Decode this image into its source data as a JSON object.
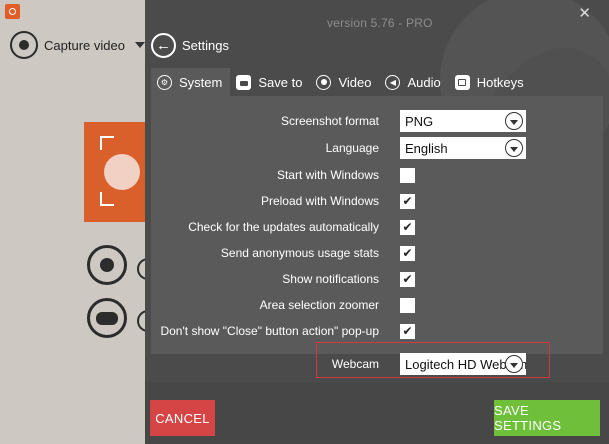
{
  "background_app": {
    "capture_label": "Capture video",
    "logo_icon": "app-logo-icon",
    "colors": {
      "accent": "#d9602a"
    }
  },
  "settings": {
    "version": "version 5.76 - PRO",
    "title": "Settings",
    "close_glyph": "✕",
    "tabs": [
      {
        "label": "System",
        "icon": "gears-icon",
        "active": true
      },
      {
        "label": "Save to",
        "icon": "folder-icon",
        "active": false
      },
      {
        "label": "Video",
        "icon": "record-icon",
        "active": false
      },
      {
        "label": "Audio",
        "icon": "speaker-icon",
        "active": false
      },
      {
        "label": "Hotkeys",
        "icon": "keyboard-icon",
        "active": false
      }
    ],
    "rows": {
      "screenshot_format": {
        "label": "Screenshot format",
        "value": "PNG"
      },
      "language": {
        "label": "Language",
        "value": "English"
      },
      "start_with_windows": {
        "label": "Start with Windows",
        "checked": false
      },
      "preload_with_windows": {
        "label": "Preload with Windows",
        "checked": true
      },
      "check_updates": {
        "label": "Check for the updates automatically",
        "checked": true
      },
      "anonymous_stats": {
        "label": "Send anonymous usage stats",
        "checked": true
      },
      "show_notifications": {
        "label": "Show notifications",
        "checked": true
      },
      "area_zoomer": {
        "label": "Area selection zoomer",
        "checked": false
      },
      "dont_show_close": {
        "label": "Don't show \"Close\" button action\" pop-up",
        "checked": true
      },
      "webcam": {
        "label": "Webcam",
        "value": "Logitech HD Webcam"
      }
    },
    "check_glyph": "✔",
    "footer": {
      "cancel_label": "CANCEL",
      "save_label": "SAVE SETTINGS"
    },
    "colors": {
      "cancel": "#d64545",
      "save": "#6fbf3b",
      "highlight": "#d03a3a"
    }
  }
}
